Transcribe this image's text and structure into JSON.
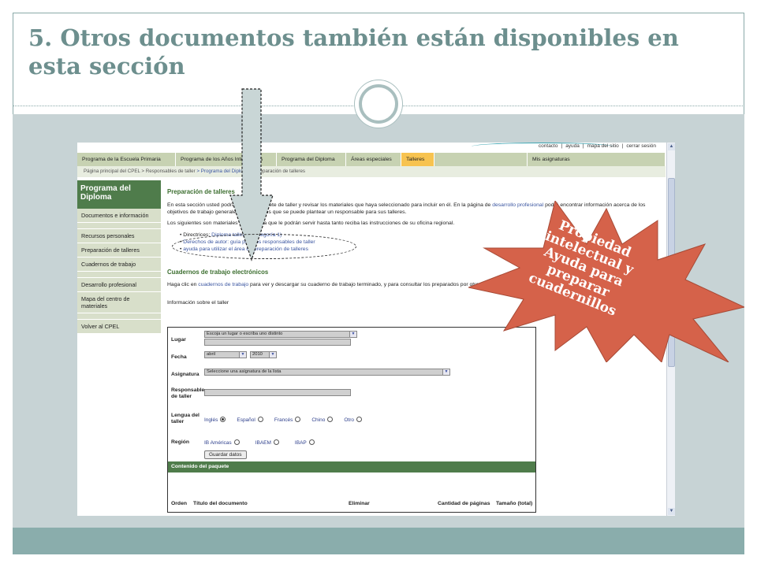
{
  "slide": {
    "title": "5. Otros documentos también están disponibles en esta sección"
  },
  "callout": {
    "text": "Propiedad intelectual y Ayuda para preparar cuadernillos",
    "color": "#d5624a"
  },
  "web": {
    "toplinks": [
      "contacto",
      "|",
      "ayuda",
      "|",
      "mapa del sitio",
      "|",
      "cerrar sesión"
    ],
    "nav": [
      "Programa de la Escuela Primaria",
      "Programa de los Años Intermedios",
      "Programa del Diploma",
      "Áreas especiales",
      "Talleres",
      "",
      "Mis asignaturas"
    ],
    "breadcrumb": {
      "home": "Página principal del CPEL",
      "sep1": " > ",
      "resp": "Responsables de taller",
      "sep2": " > ",
      "prog": "Programa del Diploma",
      "sep3": " > ",
      "current": "Preparación de talleres"
    },
    "sidebar": {
      "head": "Programa del Diploma",
      "items": [
        "Documentos e información",
        "Recursos personales",
        "Preparación de talleres",
        "Cuadernos de trabajo",
        "Desarrollo profesional",
        "Mapa del centro de materiales",
        "Volver al CPEL"
      ]
    },
    "main": {
      "h1": "Preparación de talleres",
      "p1a": "En esta sección usted podrá crear su paquete de taller y revisar los materiales que haya seleccionado para incluir en él. En la página de ",
      "p1link": "desarrollo profesional",
      "p1b": " podrá encontrar información acerca de los objetivos de trabajo generales y específicos que se puede plantear un responsable para sus talleres.",
      "p2": "Los siguientes son materiales de consulta que le podrán servir hasta tanto reciba las instrucciones de su oficina regional.",
      "b1a": "Directrices: ",
      "b1link": "Diploma talleres (categoría 1)",
      "b2": "Derechos de autor: guía para los responsables de taller",
      "b3": "ayuda para utilizar el área de preparación de talleres",
      "h2": "Cuadernos de trabajo electrónicos",
      "p3a": "Haga clic en ",
      "p3link": "cuadernos de trabajo",
      "p3b": " para ver y descargar su cuaderno de trabajo terminado, y para consultar los preparados por otros responsables.",
      "info": "Información sobre el taller"
    },
    "form": {
      "lugar_label": "Lugar",
      "lugar_value": "Escoja un lugar o escriba uno distinto",
      "fecha_label": "Fecha",
      "fecha_month": "abril",
      "fecha_year": "2010",
      "asig_label": "Asignatura",
      "asig_value": "Seleccione una asignatura de la lista",
      "resp_label": "Responsable de taller",
      "lengua_label": "Lengua del taller",
      "lenguas": [
        "Inglés",
        "Español",
        "Francés",
        "Chino",
        "Otro"
      ],
      "region_label": "Región",
      "regiones": [
        "IB Américas",
        "IBAEM",
        "IBAP"
      ],
      "save": "Guardar datos",
      "pkg": "Contenido del paquete",
      "cols": [
        "Orden",
        "Título del documento",
        "Eliminar",
        "Cantidad de páginas",
        "Tamaño (total)"
      ]
    }
  }
}
